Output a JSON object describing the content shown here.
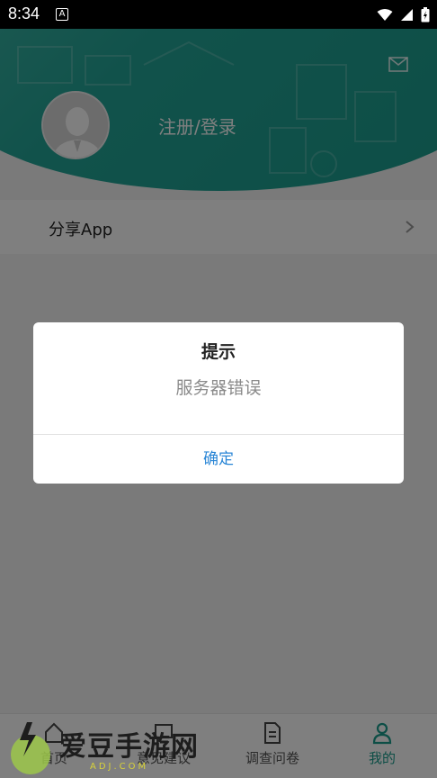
{
  "status_bar": {
    "time": "8:34",
    "notification_icon": "A"
  },
  "header": {
    "login_text": "注册/登录",
    "mail_icon": "mail-icon"
  },
  "menu": {
    "share_label": "分享App"
  },
  "bottom_nav": {
    "items": [
      {
        "label": "首页",
        "icon": "home-icon"
      },
      {
        "label": "意见建议",
        "icon": "message-icon"
      },
      {
        "label": "调查问卷",
        "icon": "document-icon"
      },
      {
        "label": "我的",
        "icon": "person-icon",
        "active": true
      }
    ]
  },
  "dialog": {
    "title": "提示",
    "message": "服务器错误",
    "confirm_label": "确定"
  },
  "watermark": {
    "text": "爱豆手游网",
    "sub": "ADJ.COM"
  },
  "colors": {
    "accent": "#1a9c8d",
    "header_gradient_start": "#4bbfae",
    "dialog_button": "#2a86d6",
    "overlay": "rgba(0,0,0,0.5)"
  }
}
